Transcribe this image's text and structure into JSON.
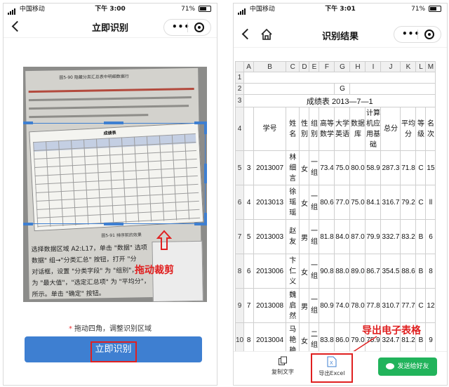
{
  "left_phone": {
    "status": {
      "carrier": "中国移动",
      "time": "下午 3:00",
      "battery": "71%"
    },
    "title": "立即识别",
    "hint": "拖动四角，调整识别区域",
    "cta": "立即识别",
    "annotation": "拖动裁剪",
    "photo": {
      "header": "图5-90 隐藏分类汇总表中明细数据行",
      "line1": "6. 使用分类汇总要各个组平均分数与同组所有男女生的平均分数",
      "caption": "图5-91 排序前的效果",
      "para1": "选择数据区域 A2:L17，单击 \"数据\" 选项",
      "para2": "数据\" 组→\"分类汇总\" 按钮，打开 \"分",
      "para3": "对话框，设置 \"分类字段\" 为 \"组别\"，",
      "para4": "为 \"最大值\"，\"选定汇总项\" 为 \"平均分\"，",
      "para5": "所示。单击 \"确定\" 按钮。",
      "para6": "数据变为图 5-93 所示",
      "table_title": "成绩表"
    }
  },
  "right_phone": {
    "status": {
      "carrier": "中国移动",
      "time": "下午 3:01",
      "battery": "71%"
    },
    "title": "识别结果",
    "columns": [
      "A",
      "B",
      "C",
      "D",
      "E",
      "F",
      "G",
      "H",
      "I",
      "J",
      "K",
      "L",
      "M"
    ],
    "row_numbers": [
      "1",
      "2",
      "3",
      "4",
      "5",
      "6",
      "7",
      "8",
      "9",
      "10",
      "11"
    ],
    "row2_g": "G",
    "row3_title": "成绩表  2013—7—1",
    "headers": [
      "学号",
      "姓名",
      "性别",
      "组别",
      "高等数学",
      "大学英语",
      "数据库",
      "计算机应用基础",
      "总分",
      "平均分",
      "等级",
      "名次"
    ],
    "rows": [
      {
        "a": "3",
        "b": "2013007",
        "c": "林细言",
        "d": "女",
        "e": "一组",
        "f": "73.4",
        "g": "75.0",
        "h": "80.0",
        "i": "58.9",
        "j": "287.3",
        "k": "71.8",
        "l": "C",
        "m": "15"
      },
      {
        "a": "4",
        "b": "2013013",
        "c": "徐瑶瑶",
        "d": "女",
        "e": "一组",
        "f": "80.6",
        "g": "77.0",
        "h": "75.0",
        "i": "84.1",
        "j": "316.7",
        "k": "79.2",
        "l": "C",
        "m": "ll"
      },
      {
        "a": "5",
        "b": "2013003",
        "c": "赵友",
        "d": "男",
        "e": "一组",
        "f": "81.8",
        "g": "84.0",
        "h": "87.0",
        "i": "79.9",
        "j": "332.7",
        "k": "83.2",
        "l": "B",
        "m": "6"
      },
      {
        "a": "6",
        "b": "2013006",
        "c": "卞仁义",
        "d": "女",
        "e": "一组",
        "f": "90.8",
        "g": "88.0",
        "h": "89.0",
        "i": "86.7",
        "j": "354.5",
        "k": "88.6",
        "l": "B",
        "m": "8"
      },
      {
        "a": "7",
        "b": "2013008",
        "c": "魏启然",
        "d": "男",
        "e": "一组",
        "f": "80.9",
        "g": "74.0",
        "h": "78.0",
        "i": "77.8",
        "j": "310.7",
        "k": "77.7",
        "l": "C",
        "m": "12"
      },
      {
        "a": "8",
        "b": "2013004",
        "c": "马艳艳",
        "d": "女",
        "e": "二组",
        "f": "83.8",
        "g": "86.0",
        "h": "79.0",
        "i": "75.9",
        "j": "324.7",
        "k": "81.2",
        "l": "B",
        "m": "9"
      },
      {
        "a": "9",
        "b": "2013009",
        "c": "支...",
        "d": "",
        "e": "一",
        "f": "",
        "g": "",
        "h": "",
        "i": "",
        "j": "",
        "k": "",
        "l": "",
        "m": ""
      }
    ],
    "toolbar": {
      "copy": "复制文字",
      "excel": "导出Excel",
      "share": "发送给好友"
    },
    "annotation": "导出电子表格"
  }
}
